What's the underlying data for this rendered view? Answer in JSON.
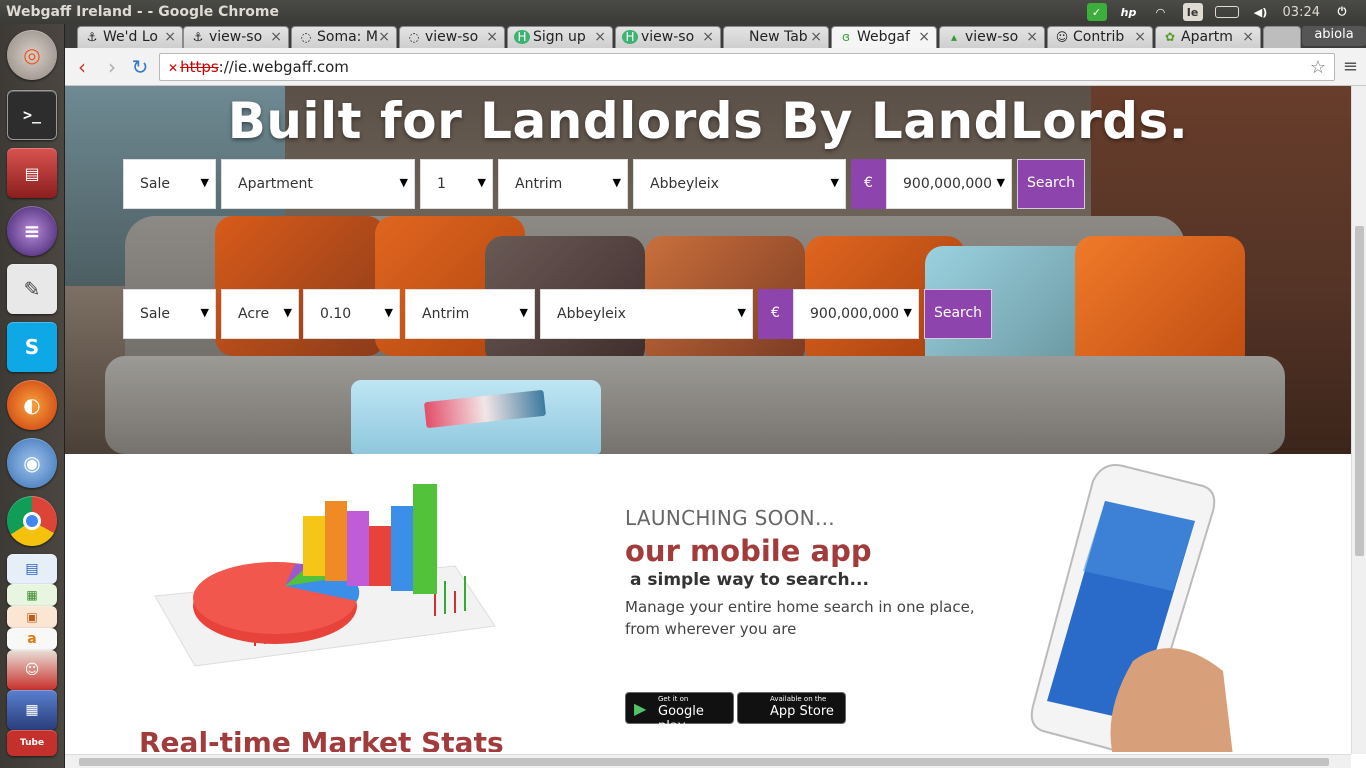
{
  "os_panel": {
    "window_title": "Webgaff Ireland - - Google Chrome",
    "keyboard_layout": "Ie",
    "clock": "03:24",
    "tray_icons": [
      "check-icon",
      "hp-icon",
      "wifi-icon",
      "keyboard-icon",
      "battery-icon",
      "volume-icon",
      "power-icon"
    ]
  },
  "launcher": {
    "items": [
      "ubuntu-dash-icon",
      "terminal-icon",
      "file-manager-icon",
      "eclipse-icon",
      "text-editor-icon",
      "skype-icon",
      "firefox-icon",
      "chromium-icon",
      "chrome-icon",
      "libreoffice-writer-icon",
      "libreoffice-calc-icon",
      "libreoffice-impress-icon",
      "amazon-icon",
      "software-center-icon",
      "workspaces-icon",
      "youtube-icon"
    ]
  },
  "browser": {
    "tabs": [
      {
        "label": "We'd Lo",
        "icon": "anchor-icon",
        "fav": "⚓"
      },
      {
        "label": "view-so",
        "icon": "anchor-icon",
        "fav": "⚓"
      },
      {
        "label": "Soma: M",
        "icon": "loading-icon",
        "fav": "◌"
      },
      {
        "label": "view-so",
        "icon": "loading-icon",
        "fav": "◌"
      },
      {
        "label": "Sign up",
        "icon": "h-icon",
        "fav": "H"
      },
      {
        "label": "view-so",
        "icon": "h-icon",
        "fav": "H"
      },
      {
        "label": "New Tab",
        "icon": "",
        "fav": ""
      },
      {
        "label": "Webgaf",
        "icon": "webgaff-icon",
        "fav": "ɞ"
      },
      {
        "label": "view-so",
        "icon": "webgaff-icon",
        "fav": "▴"
      },
      {
        "label": "Contrib",
        "icon": "cat-icon",
        "fav": "☺"
      },
      {
        "label": "Apartm",
        "icon": "gear-icon",
        "fav": "✿"
      }
    ],
    "profile": "abiola",
    "url_scheme": "https",
    "url_host": "://ie.webgaff.com"
  },
  "hero": {
    "title": "Built for Landlords By LandLords.",
    "row1": {
      "type": "Sale",
      "property": "Apartment",
      "beds": "1",
      "county": "Antrim",
      "town": "Abbeyleix",
      "currency": "€",
      "price": "900,000,000",
      "button": "Search"
    },
    "row2": {
      "type": "Sale",
      "unit": "Acre",
      "size": "0.10",
      "county": "Antrim",
      "town": "Abbeyleix",
      "currency": "€",
      "price": "900,000,000",
      "button": "Search"
    }
  },
  "promo": {
    "kicker": "LAUNCHING SOON...",
    "headline": "our mobile app",
    "sub": "a simple way to search...",
    "desc": "Manage your entire home search in one place, from wherever you are",
    "google_small": "Get it on",
    "google_big": "Google play",
    "apple_small": "Available on the",
    "apple_big": "App Store"
  },
  "stats_title": "Real-time Market Stats",
  "colors": {
    "accent": "#8e44ad",
    "headline": "#a23b3b"
  }
}
